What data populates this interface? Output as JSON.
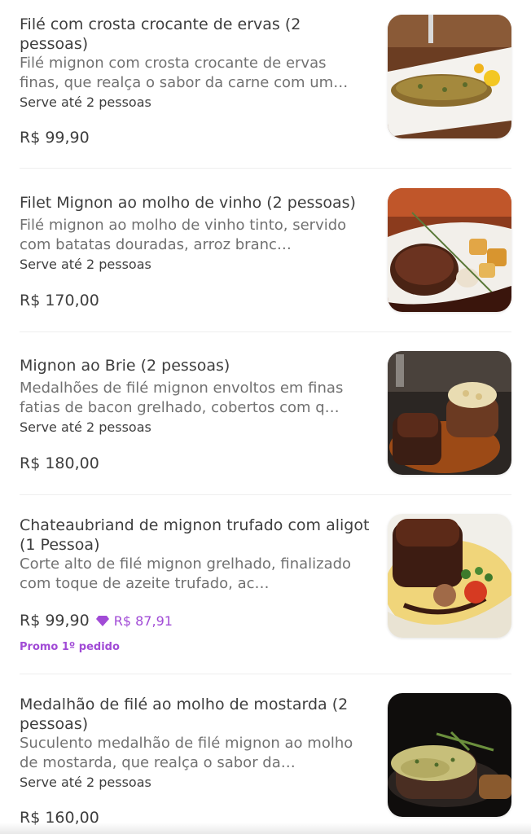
{
  "items": [
    {
      "title": "Filé com crosta crocante de ervas (2 pessoas)",
      "description": "Filé mignon com crosta crocante de ervas finas, que realça o sabor da carne com um…",
      "serves": "Serve até 2 pessoas",
      "price": "R$ 99,90",
      "image_icon": "herb-crusted-steak-photo"
    },
    {
      "title": "Filet Mignon ao molho de vinho (2 pessoas)",
      "description": "Filé mignon ao molho de vinho tinto, servido com batatas douradas, arroz branc…",
      "serves": "Serve até 2 pessoas",
      "price": "R$ 170,00",
      "image_icon": "steak-wine-sauce-photo"
    },
    {
      "title": "Mignon ao Brie (2 pessoas)",
      "description": "Medalhões de filé mignon envoltos em finas fatias de bacon grelhado, cobertos com q…",
      "serves": "Serve até 2 pessoas",
      "price": "R$ 180,00",
      "image_icon": "mignon-brie-photo"
    },
    {
      "title": "Chateaubriand de mignon trufado com aligot (1 Pessoa)",
      "description": "Corte alto de filé mignon grelhado, finalizado com toque de azeite trufado, ac…",
      "price": "R$ 99,90",
      "promo_price": "R$ 87,91",
      "promo_label": "Promo 1º pedido",
      "promo_color": "#a14bd6",
      "image_icon": "chateaubriand-aligot-photo"
    },
    {
      "title": "Medalhão de filé ao molho de mostarda (2 pessoas)",
      "description": "Suculento medalhão de filé mignon ao molho de mostarda, que realça o sabor da…",
      "serves": "Serve até 2 pessoas",
      "price": "R$ 160,00",
      "image_icon": "medallion-mustard-photo"
    }
  ]
}
